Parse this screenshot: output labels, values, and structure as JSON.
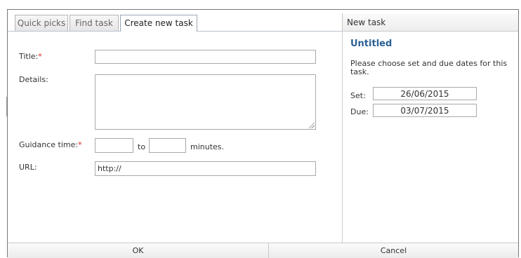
{
  "tabs": [
    {
      "label": "Quick picks"
    },
    {
      "label": "Find task"
    },
    {
      "label": "Create new task"
    }
  ],
  "form": {
    "title_label": "Title:",
    "title_value": "",
    "details_label": "Details:",
    "details_value": "",
    "guidance_label": "Guidance time:",
    "guidance_from": "",
    "to_label": "to",
    "guidance_to": "",
    "minutes_label": "minutes.",
    "url_label": "URL:",
    "url_value": "http://",
    "required_mark": "*"
  },
  "panel": {
    "header": "New task",
    "task_title": "Untitled",
    "instruction": "Please choose set and due dates for this task.",
    "set_label": "Set:",
    "set_date": "26/06/2015",
    "due_label": "Due:",
    "due_date": "03/07/2015"
  },
  "actions": {
    "ok": "OK",
    "cancel": "Cancel"
  },
  "colors": {
    "title_accent": "#2b5f93",
    "required": "#d42a2a"
  }
}
